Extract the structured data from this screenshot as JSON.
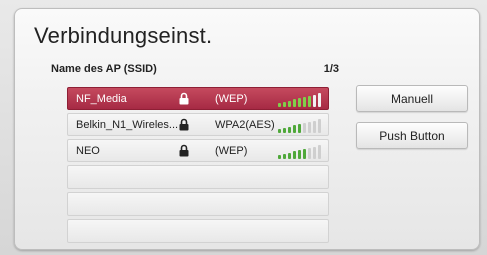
{
  "dialog": {
    "title": "Verbindungseinst.",
    "list_header": "Name des AP (SSID)",
    "page_indicator": "1/3"
  },
  "access_points": [
    {
      "ssid": "NF_Media",
      "secured": true,
      "security": "(WEP)",
      "signal_bars": 7,
      "signal_max": 9,
      "selected": true
    },
    {
      "ssid": "Belkin_N1_Wireles...",
      "secured": true,
      "security": "WPA2(AES)",
      "signal_bars": 5,
      "signal_max": 9,
      "selected": false
    },
    {
      "ssid": "NEO",
      "secured": true,
      "security": "(WEP)",
      "signal_bars": 6,
      "signal_max": 9,
      "selected": false
    }
  ],
  "empty_rows": 3,
  "buttons": {
    "manual_label": "Manuell",
    "push_label": "Push Button"
  },
  "colors": {
    "selected_row": "#b13650",
    "signal_active": "#4fa83a",
    "signal_inactive": "#cfcfcf",
    "signal_active_selected": "#7fcf4a",
    "signal_inactive_selected": "#f2f2f2"
  }
}
